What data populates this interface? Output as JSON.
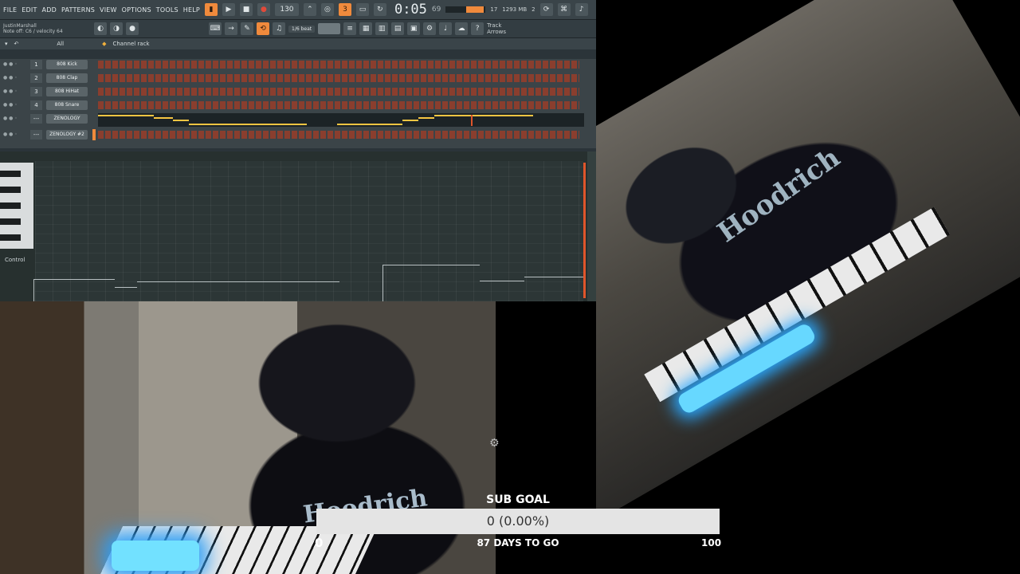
{
  "daw": {
    "menu": [
      "FILE",
      "EDIT",
      "ADD",
      "PATTERNS",
      "VIEW",
      "OPTIONS",
      "TOOLS",
      "HELP"
    ],
    "time": "0:05",
    "time_sub": "69",
    "hint_line1": "JustinMarshall",
    "hint_line2": "Note off: C6 / velocity 64",
    "cpu": "17",
    "mem": "1293 MB",
    "polyphony": "2",
    "snap_label": "1/6 beat",
    "rack_filter": "All",
    "rack_title": "Channel rack",
    "channels": [
      {
        "num": "1",
        "name": "808 Kick"
      },
      {
        "num": "2",
        "name": "808 Clap"
      },
      {
        "num": "3",
        "name": "808 HiHat"
      },
      {
        "num": "4",
        "name": "808 Snare"
      },
      {
        "num": "---",
        "name": "ZENOLOGY"
      },
      {
        "num": "---",
        "name": "ZENOLOGY #2"
      }
    ],
    "control_label": "Control",
    "arrows_label": "Arrows",
    "track_label": "Track"
  },
  "overlay": {
    "title": "SUB GOAL",
    "value_text": "0 (0.00%)",
    "progress_fraction": 0,
    "min": "0",
    "days": "87 DAYS TO GO",
    "max": "100"
  },
  "webcam": {
    "shirt_text": "Hoodrich"
  },
  "icons": {
    "settings": "gear-icon",
    "play": "play-icon",
    "stop": "stop-icon",
    "record": "record-icon"
  },
  "colors": {
    "accent": "#f08a3c",
    "step": "#8a3e2e",
    "note": "#f5c542",
    "playhead": "#e0552b",
    "bar_bg": "#e4e4e4"
  }
}
